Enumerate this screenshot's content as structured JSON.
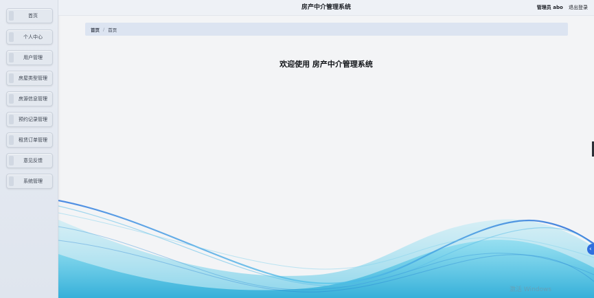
{
  "header": {
    "title": "房产中介管理系统",
    "user": "管理员 abo",
    "logout": "退出登录"
  },
  "sidebar": {
    "items": [
      {
        "label": "首页"
      },
      {
        "label": "个人中心"
      },
      {
        "label": "用户管理"
      },
      {
        "label": "房屋类型管理"
      },
      {
        "label": "房源信息管理"
      },
      {
        "label": "预约记录管理"
      },
      {
        "label": "租赁订单管理"
      },
      {
        "label": "意见反馈"
      },
      {
        "label": "系统管理"
      }
    ]
  },
  "breadcrumb": {
    "home": "首页",
    "separator": "/",
    "current": "首页"
  },
  "main": {
    "welcome": "欢迎使用 房产中介管理系统"
  },
  "watermark": "激活 Windows",
  "colors": {
    "accent": "#2f6fde",
    "wave_light": "#5fd0e8",
    "wave_dark": "#1e6fd9"
  }
}
